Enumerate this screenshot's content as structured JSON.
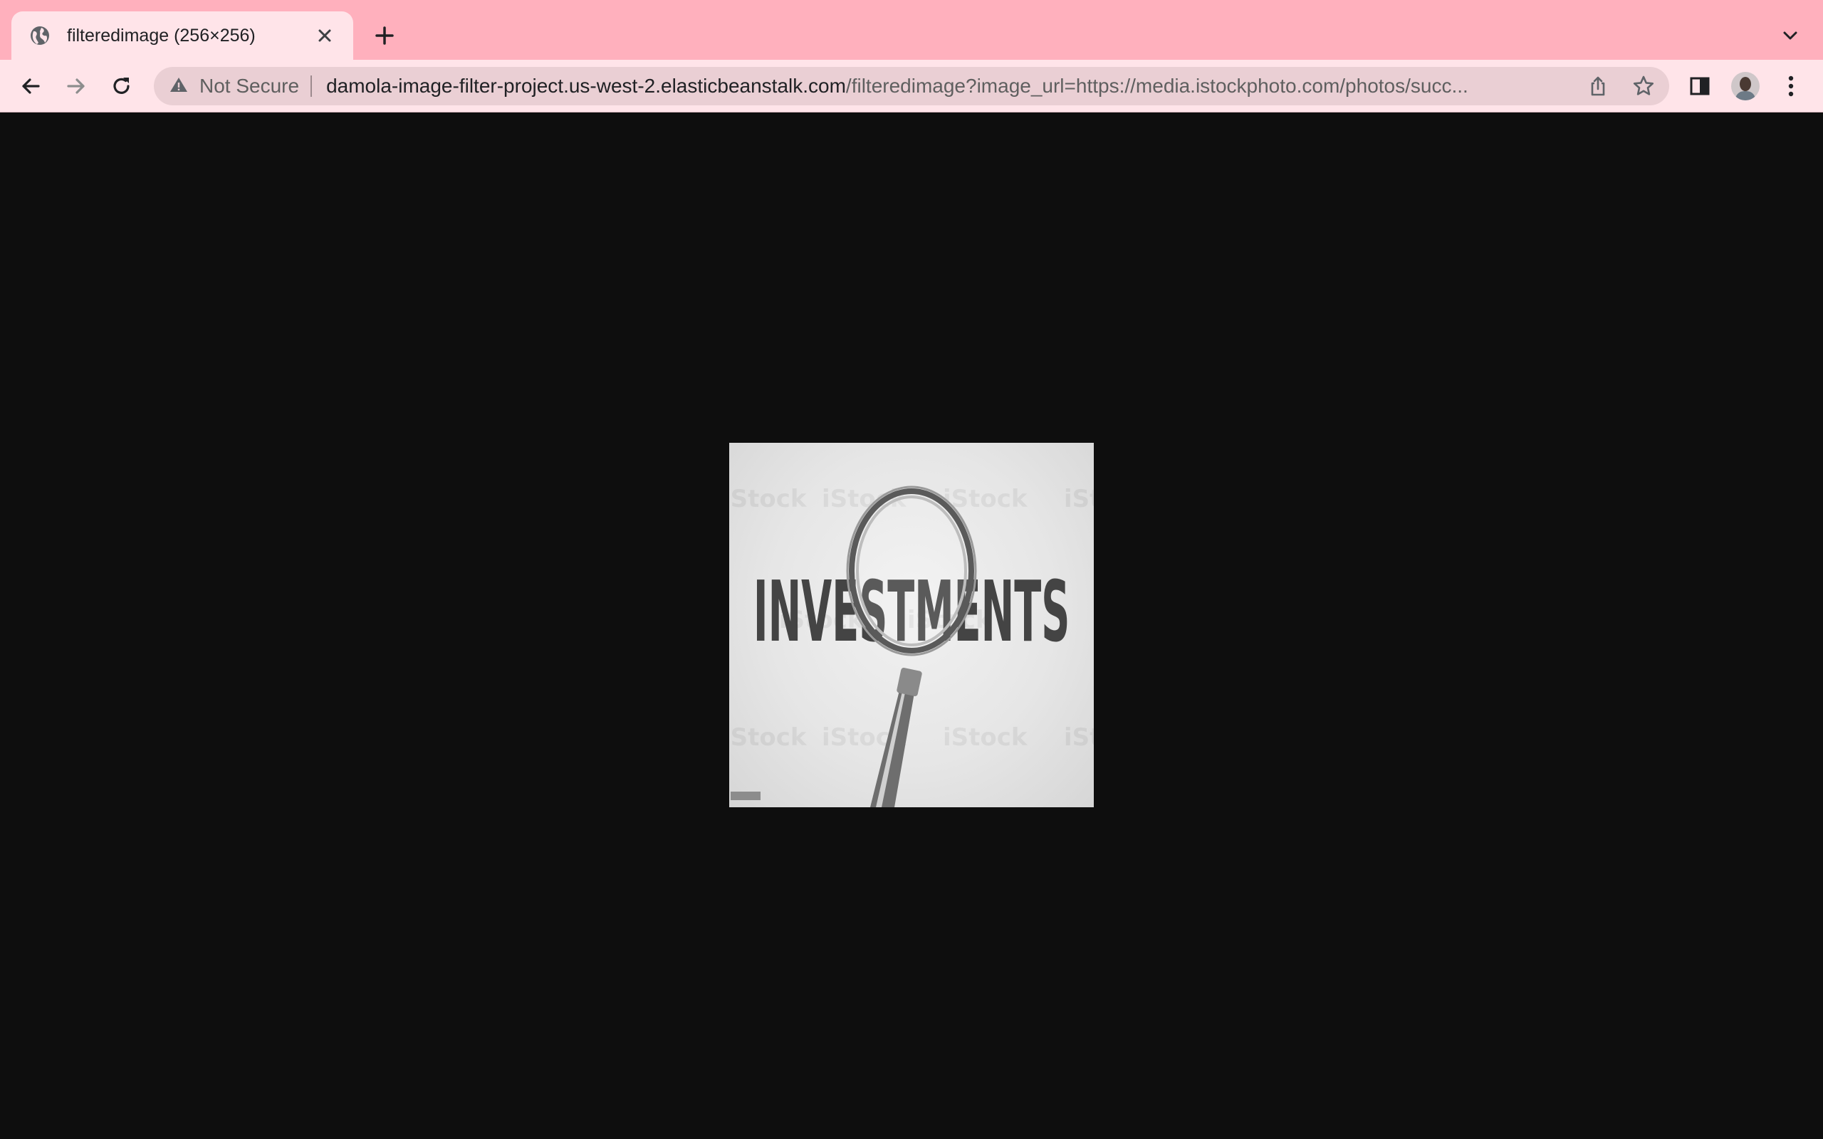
{
  "browser": {
    "tab": {
      "title": "filteredimage (256×256)",
      "favicon": "globe-icon"
    },
    "toolbar": {
      "security_label": "Not Secure",
      "url_host": "damola-image-filter-project.us-west-2.elasticbeanstalk.com",
      "url_path": "/filteredimage?image_url=https://media.istockphoto.com/photos/succ..."
    },
    "colors": {
      "tabstrip_bg": "#ffb0bd",
      "toolbar_bg": "#ffe4e9",
      "omnibox_bg": "#eacfd4",
      "page_bg": "#0e0e0e"
    }
  },
  "image": {
    "text": "INVESTMENTS",
    "watermark": "iStock",
    "filter": "grayscale"
  }
}
